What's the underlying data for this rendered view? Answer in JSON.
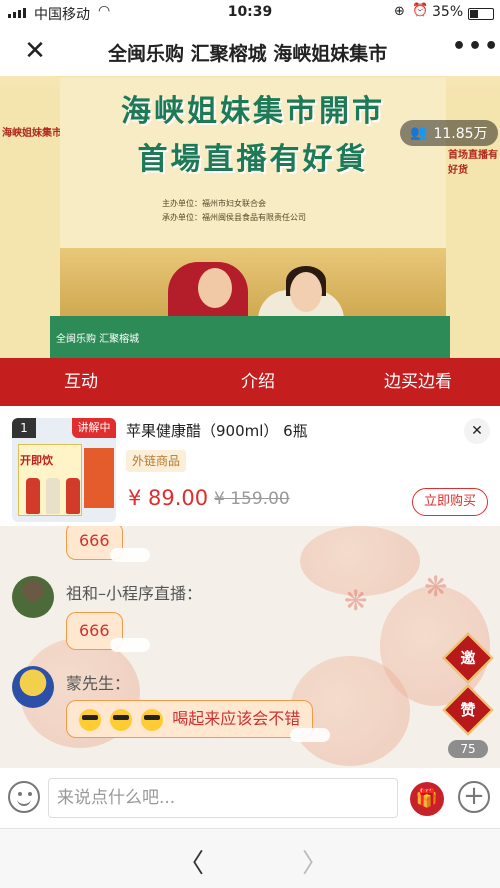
{
  "status_bar": {
    "carrier": "中国移动",
    "time": "10:39",
    "battery": "35%"
  },
  "nav": {
    "title": "全闽乐购 汇聚榕城 海峡姐妹集市"
  },
  "video": {
    "headline_line1": "海峡姐妹集市開市",
    "headline_line2": "首場直播有好貨",
    "sponsor_line1": "主办单位：福州市妇女联合会",
    "sponsor_line2": "承办单位：福州闽侯县食品有限责任公司",
    "side_left_text": "海峡姐妹集市开市",
    "side_right_text": "首场直播有好货",
    "table_text": "全闽乐购  汇聚榕城",
    "viewers": "11.85万"
  },
  "tabs": [
    "互动",
    "介绍",
    "边买边看"
  ],
  "product": {
    "index": "1",
    "live_badge": "讲解中",
    "thumb_text": "开即饮",
    "name": "苹果健康醋（900ml） 6瓶",
    "tag": "外链商品",
    "price": "¥ 89.00",
    "original_price": "¥ 159.00",
    "buy_label": "立即购买"
  },
  "chat": {
    "messages": [
      {
        "text": "666"
      },
      {
        "user": "祖和–小程序直播：",
        "text": "666"
      },
      {
        "user": "蒙先生：",
        "text": "喝起来应该会不错"
      }
    ],
    "invite_label": "邀",
    "like_label": "赞",
    "like_count": "75"
  },
  "input": {
    "placeholder": "来说点什么吧..."
  },
  "icons": {
    "close": "close-icon",
    "more": "more-icon",
    "viewers": "people-icon",
    "emoji": "emoji-icon",
    "gift": "gift-icon",
    "plus": "plus-icon",
    "back": "back-arrow-icon",
    "forward": "forward-arrow-icon"
  },
  "colors": {
    "tab_bar": "#c41e1e",
    "price": "#e02d2d",
    "headline": "#1d7a55"
  }
}
